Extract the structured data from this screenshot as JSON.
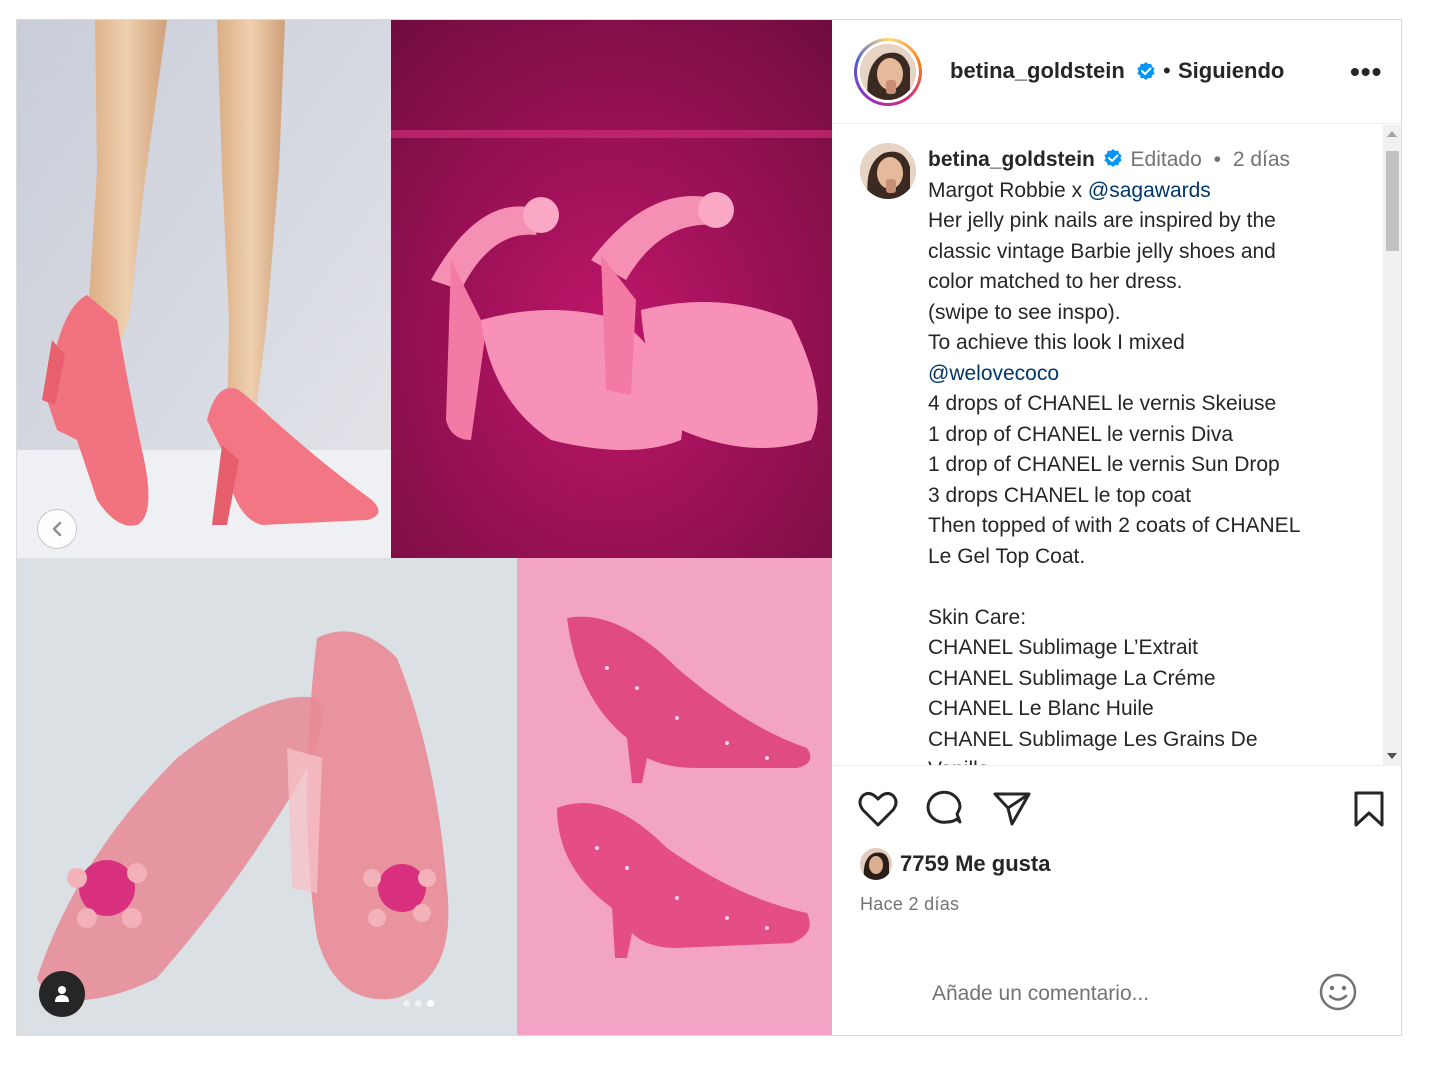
{
  "post": {
    "author": {
      "username": "betina_goldstein",
      "verified": true,
      "follow_status": "Siguiendo",
      "separator": "•"
    },
    "more_options_label": "•••",
    "caption": {
      "username": "betina_goldstein",
      "edited_label": "Editado",
      "meta_separator": "•",
      "time_ago": "2 días",
      "lines": [
        {
          "text": "Margot Robbie x ",
          "mention": "@sagawards"
        },
        {
          "text": "Her jelly pink nails are inspired by the"
        },
        {
          "text": "classic vintage Barbie jelly shoes and"
        },
        {
          "text": "color matched to her dress."
        },
        {
          "text": "(swipe to see inspo)."
        },
        {
          "text": "To achieve this look I mixed"
        },
        {
          "text": "",
          "mention": "@welovecoco"
        },
        {
          "text": "4 drops of CHANEL le vernis Skeiuse"
        },
        {
          "text": "1 drop of CHANEL le vernis Diva"
        },
        {
          "text": "1 drop of CHANEL le vernis Sun Drop"
        },
        {
          "text": "3 drops CHANEL le top coat"
        },
        {
          "text": "Then topped of with 2 coats of CHANEL"
        },
        {
          "text": "Le Gel Top Coat."
        },
        {
          "text": ""
        },
        {
          "text": "Skin Care:"
        },
        {
          "text": "CHANEL Sublimage L’Extrait"
        },
        {
          "text": "CHANEL Sublimage La Créme"
        },
        {
          "text": "CHANEL Le Blanc Huile"
        },
        {
          "text": "CHANEL Sublimage Les Grains De"
        },
        {
          "text": "Vanilla"
        }
      ]
    },
    "likes": {
      "count": "7759",
      "label": "Me gusta"
    },
    "posted_ago": "Hace 2 días",
    "comment": {
      "placeholder": "Añade un comentario...",
      "value": ""
    },
    "carousel": {
      "total_slides": 3,
      "active_slide": 3
    },
    "icons": {
      "like": "heart-icon",
      "comment": "comment-bubble-icon",
      "share": "paper-plane-icon",
      "save": "bookmark-icon",
      "emoji": "smiley-icon",
      "more": "ellipsis-icon",
      "prev": "chevron-left-icon",
      "tagged_user": "user-icon",
      "verified": "verified-badge-icon"
    },
    "colors": {
      "verified": "#0095f6",
      "mention": "#00376b",
      "meta_text": "#737373"
    }
  }
}
